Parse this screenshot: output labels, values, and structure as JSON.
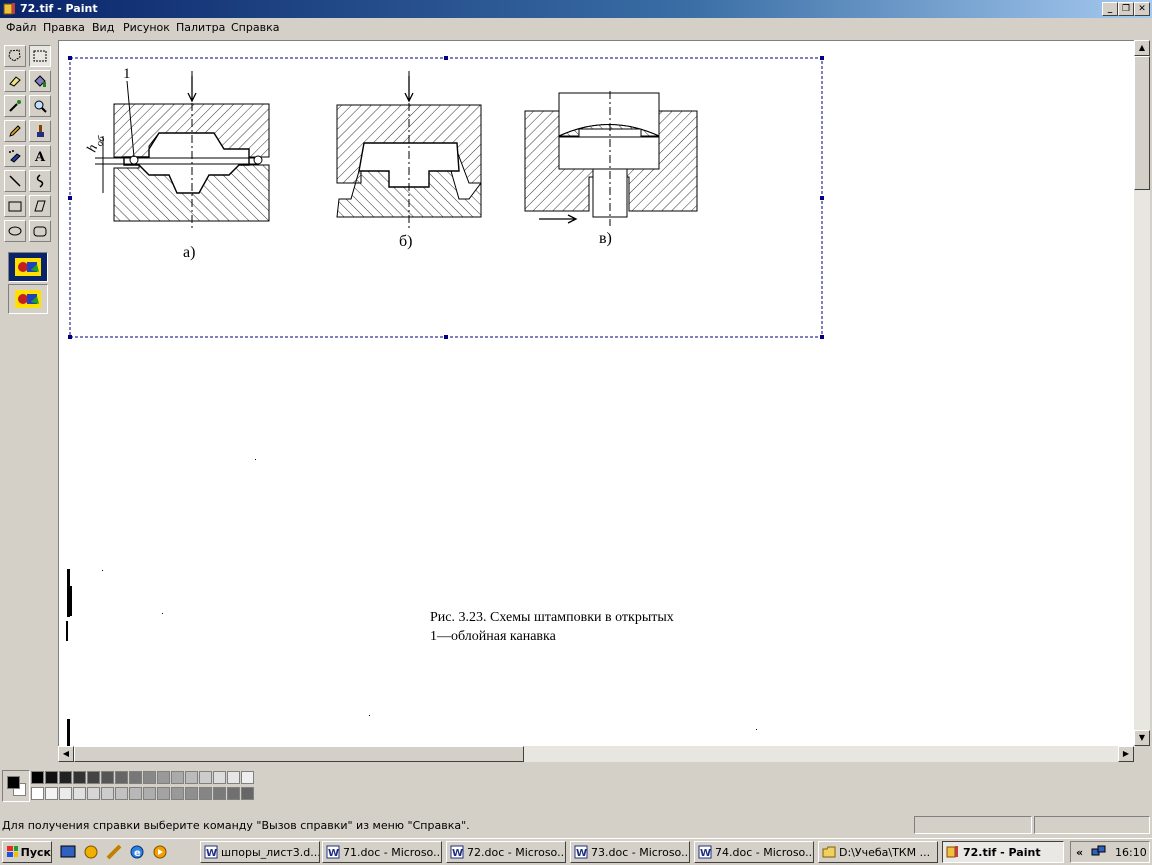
{
  "window": {
    "title": "72.tif - Paint"
  },
  "menu": [
    "Файл",
    "Правка",
    "Вид",
    "Рисунок",
    "Палитра",
    "Справка"
  ],
  "tools": [
    "free-select",
    "rect-select",
    "eraser",
    "fill",
    "picker",
    "magnifier",
    "pencil",
    "brush",
    "airbrush",
    "text",
    "line",
    "curve",
    "rectangle",
    "polygon",
    "ellipse",
    "rounded-rect"
  ],
  "figure": {
    "labels": {
      "a": "а)",
      "b": "б)",
      "c": "в)",
      "number": "1",
      "h_main": "h",
      "h_sub": "об"
    },
    "caption_line1": "Рис. 3.23. Схемы штамповки в открытых",
    "caption_line2": "1—облойная канавка"
  },
  "palette": {
    "row1": [
      "#000000",
      "#111111",
      "#222222",
      "#333333",
      "#444444",
      "#555555",
      "#666666",
      "#777777",
      "#888888",
      "#999999",
      "#aaaaaa",
      "#bbbbbb",
      "#cccccc",
      "#dddddd",
      "#e6e6e6",
      "#eeeeee"
    ],
    "row2": [
      "#ffffff",
      "#f4f4f4",
      "#ebebeb",
      "#e0e0e0",
      "#d6d6d6",
      "#cccccc",
      "#c2c2c2",
      "#b8b8b8",
      "#adadad",
      "#a3a3a3",
      "#999999",
      "#8f8f8f",
      "#858585",
      "#7a7a7a",
      "#707070",
      "#666666"
    ],
    "foreground": "#000000",
    "background": "#ffffff"
  },
  "status": {
    "text": "Для получения справки выберите команду \"Вызов справки\" из меню \"Справка\"."
  },
  "taskbar": {
    "start": "Пуск",
    "tasks": [
      "шпоры_лист3.d...",
      "71.doc - Microso...",
      "72.doc - Microso...",
      "73.doc - Microso...",
      "74.doc - Microso...",
      "D:\\Учеба\\ТКМ ...",
      "72.tif - Paint"
    ],
    "clock": "16:10",
    "tray_chevron": "«"
  }
}
